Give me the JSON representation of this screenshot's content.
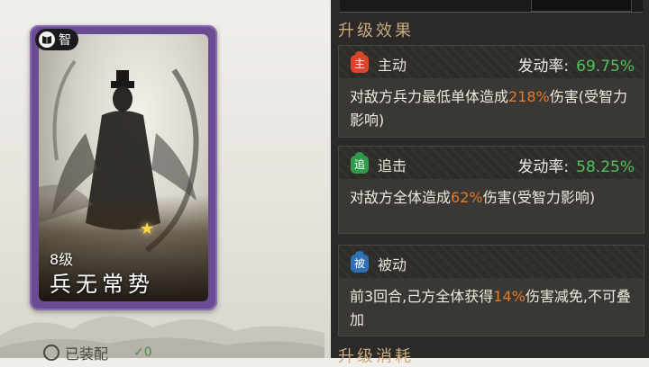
{
  "card": {
    "type_badge": "智",
    "level": "8级",
    "name": "兵无常势"
  },
  "owned": {
    "label": "已装配",
    "count": "✓0"
  },
  "sections": {
    "upgrade_effect": "升级效果",
    "upgrade_cost": "升级消耗"
  },
  "effects": [
    {
      "tag": "主",
      "tag_color": "#d8452b",
      "label": "主动",
      "rate_label": "发动率:",
      "rate_value": "69.75%",
      "desc_pre": "对敌方兵力最低单体造成",
      "desc_hl": "218%",
      "desc_post": "伤害(受智力影响)"
    },
    {
      "tag": "追",
      "tag_color": "#2e9a4a",
      "label": "追击",
      "rate_label": "发动率:",
      "rate_value": "58.25%",
      "desc_pre": "对敌方全体造成",
      "desc_hl": "62%",
      "desc_post": "伤害(受智力影响)"
    },
    {
      "tag": "被",
      "tag_color": "#2f6fb3",
      "label": "被动",
      "desc_pre": "前3回合,己方全体获得",
      "desc_hl": "14%",
      "desc_post": "伤害减免,不可叠加"
    }
  ],
  "colors": {
    "highlight": "#e07a2c",
    "rate_green": "#4fc35e",
    "section_gold": "#c8aa7d",
    "card_purple": "#6b4c92"
  }
}
